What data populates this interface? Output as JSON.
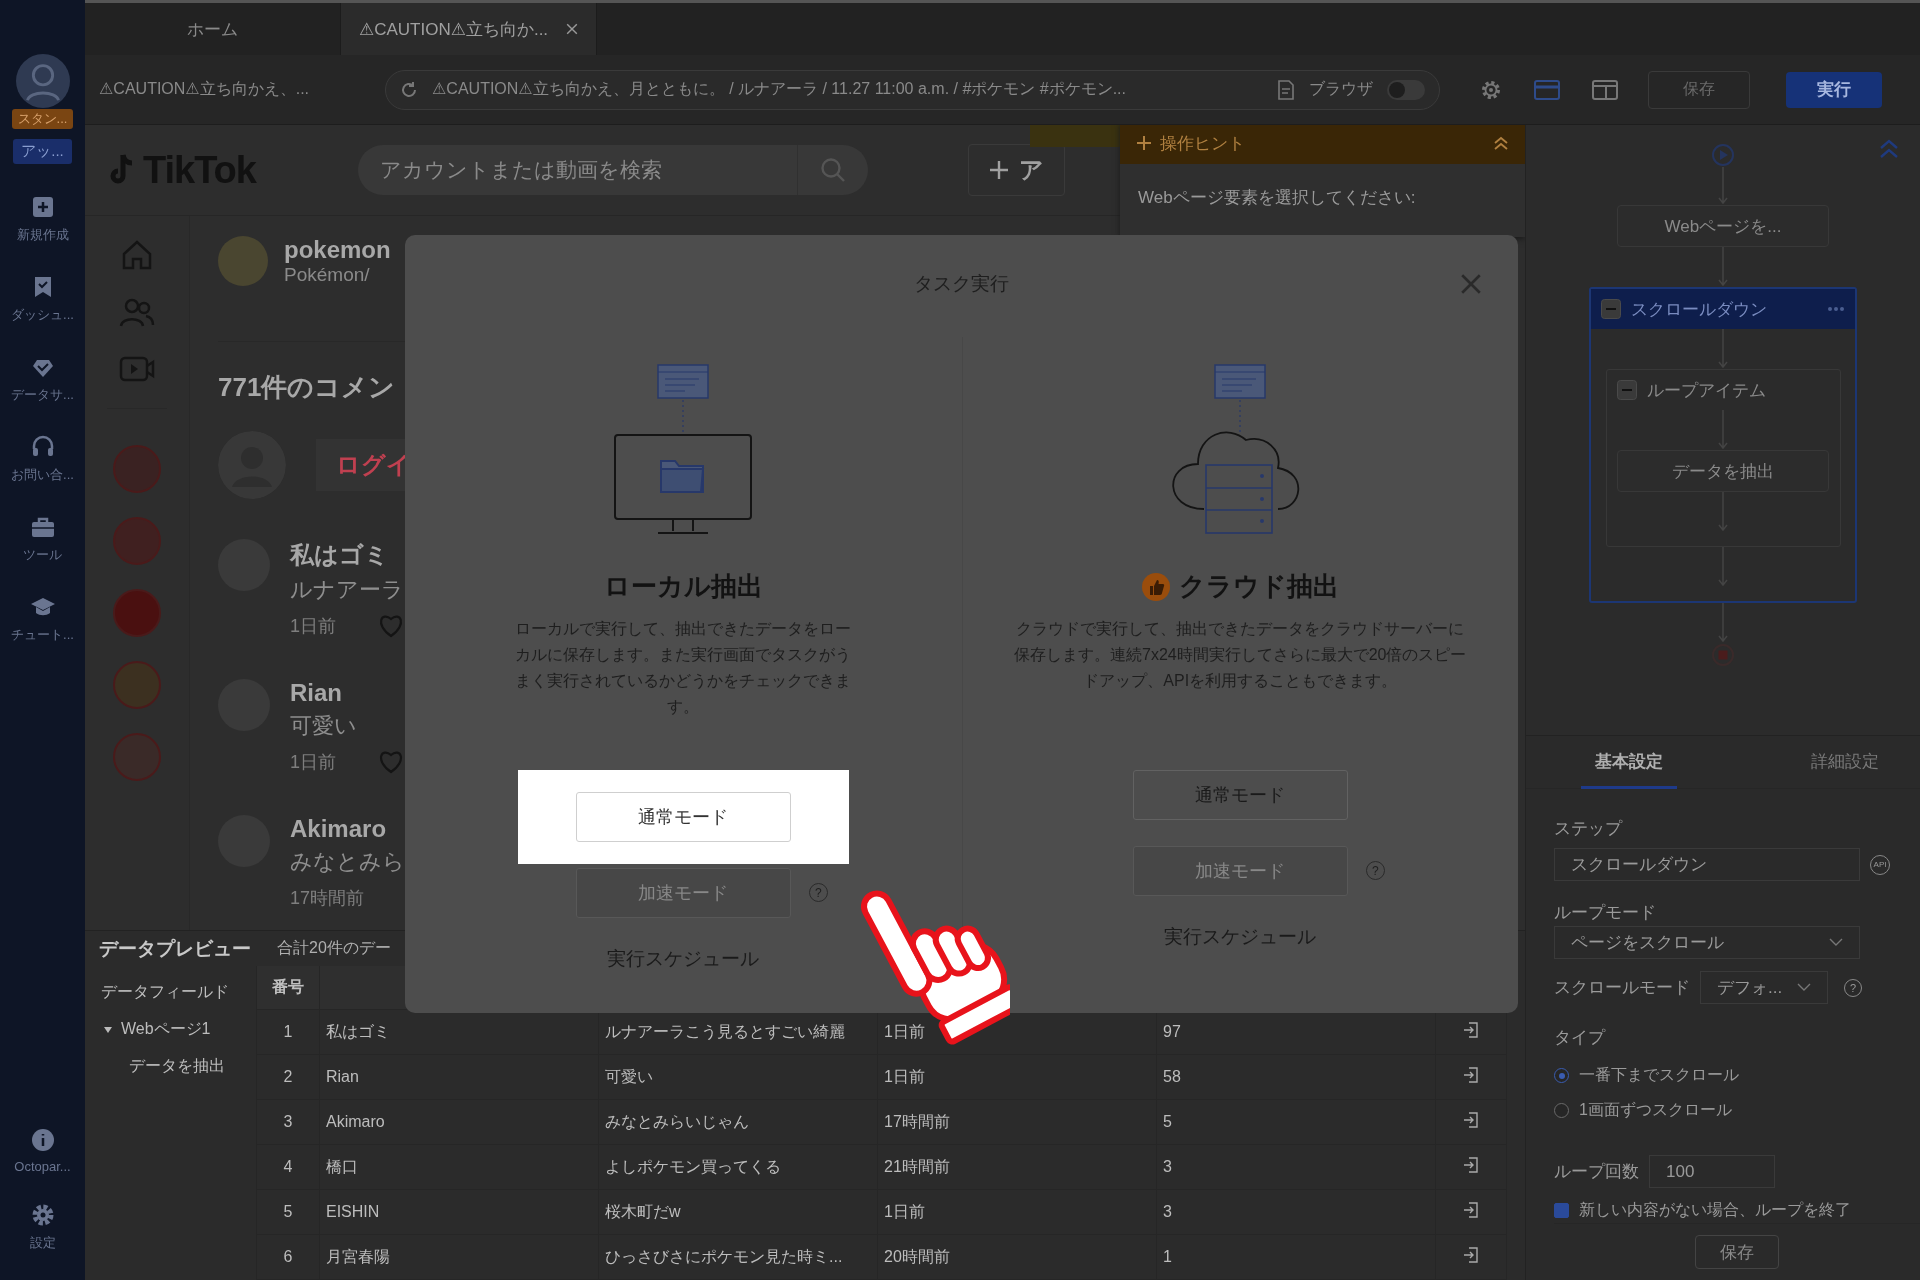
{
  "sidebar": {
    "plan_badge": "スタン...",
    "account_badge": "アッ...",
    "items": [
      {
        "label": "新規作成"
      },
      {
        "label": "ダッシュ..."
      },
      {
        "label": "データサ..."
      },
      {
        "label": "お問い合..."
      },
      {
        "label": "ツール"
      },
      {
        "label": "チュート..."
      }
    ],
    "bottom_items": [
      {
        "label": "Octopar..."
      },
      {
        "label": "設定"
      }
    ]
  },
  "tabs": [
    {
      "label": "ホーム",
      "selected": false,
      "closable": false
    },
    {
      "label": "⚠CAUTION⚠立ち向か...",
      "selected": true,
      "closable": true
    }
  ],
  "address_bar": {
    "page_title": "⚠CAUTION⚠立ち向かえ、...",
    "url": "⚠CAUTION⚠立ち向かえ、月とともに。 / ルナアーラ / 11.27 11:00 a.m. / #ポケモン #ポケモン...",
    "browser_toggle": {
      "label": "ブラウザ",
      "on": false
    }
  },
  "toolbar": {
    "save": {
      "label": "保存",
      "disabled": true
    },
    "run": {
      "label": "実行"
    }
  },
  "tiktok": {
    "logo": "TikTok",
    "search_placeholder": "アカウントまたは動画を検索",
    "upload_button": "ア",
    "account": {
      "name": "pokemon",
      "handle": "Pokémon/"
    },
    "comment_count": "771件のコメン",
    "login": "ログイ",
    "comments": [
      {
        "user": "私はゴミ",
        "text": "ルナアーラ",
        "time": "1日前",
        "heart": true
      },
      {
        "user": "Rian",
        "text": "可愛い",
        "time": "1日前",
        "heart": true
      },
      {
        "user": "Akimaro",
        "text": "みなとみら",
        "time": "17時間前",
        "heart": false
      }
    ]
  },
  "hint_panel": {
    "title": "操作ヒント",
    "text": "Webページ要素を選択してください:"
  },
  "workflow": {
    "steps": [
      {
        "kind": "action",
        "label": "Webページを..."
      },
      {
        "kind": "loop",
        "label": "スクロールダウン",
        "selected": true,
        "expanded": true,
        "children": [
          {
            "kind": "loop",
            "label": "ループアイテム",
            "selected": false,
            "expanded": true,
            "children": [
              {
                "kind": "action",
                "label": "データを抽出"
              }
            ]
          }
        ]
      }
    ]
  },
  "settings": {
    "tabs": [
      {
        "label": "基本設定",
        "selected": true
      },
      {
        "label": "詳細設定",
        "selected": false
      }
    ],
    "step_label": "ステップ",
    "step_value": "スクロールダウン",
    "api_icon": "API",
    "loop_mode_label": "ループモード",
    "loop_mode_value": "ページをスクロール",
    "scroll_mode_label": "スクロールモード",
    "scroll_mode_value": "デフォ...",
    "scroll_mode_help": "?",
    "type_label": "タイプ",
    "type_options": [
      {
        "label": "一番下までスクロール",
        "selected": true
      },
      {
        "label": "1画面ずつスクロール",
        "selected": false
      }
    ],
    "loop_count_label": "ループ回数",
    "loop_count_value": "100",
    "end_checkbox": {
      "label": "新しい内容がない場合、ループを終了",
      "checked": true
    },
    "save": "保存"
  },
  "preview": {
    "title": "データプレビュー",
    "count": "合計20件のデー",
    "fields_title": "データフィールド",
    "tree": [
      {
        "label": "Webページ1",
        "expanded": true,
        "children": [
          {
            "label": "データを抽出"
          }
        ]
      }
    ],
    "table": {
      "columns": [
        "番号"
      ],
      "rows": [
        [
          "1",
          "私はゴミ",
          "ルナアーラこう見るとすごい綺麗",
          "1日前",
          "97"
        ],
        [
          "2",
          "Rian",
          "可愛い",
          "1日前",
          "58"
        ],
        [
          "3",
          "Akimaro",
          "みなとみらいじゃん",
          "17時間前",
          "5"
        ],
        [
          "4",
          "橋口",
          "よしポケモン買ってくる",
          "21時間前",
          "3"
        ],
        [
          "5",
          "EISHIN",
          "桜木町だw",
          "1日前",
          "3"
        ],
        [
          "6",
          "月宮春陽",
          "ひっさびさにポケモン見た時ミ...",
          "20時間前",
          "1"
        ]
      ]
    }
  },
  "modal": {
    "title": "タスク実行",
    "options": [
      {
        "kind": "local",
        "title": "ローカル抽出",
        "description": "ローカルで実行して、抽出できたデータをローカルに保存します。また実行画面でタスクがうまく実行されているかどうかをチェックできます。",
        "normal_button": {
          "label": "通常モード",
          "highlighted": true
        },
        "fast_button": {
          "label": "加速モード",
          "disabled": true
        },
        "help": "?",
        "schedule": "実行スケジュール"
      },
      {
        "kind": "cloud",
        "title": "クラウド抽出",
        "description": "クラウドで実行して、抽出できたデータをクラウドサーバーに保存します。連続7x24時間実行してさらに最大で20倍のスピードアップ、APIを利用することもできます。",
        "normal_button": {
          "label": "通常モード",
          "highlighted": false
        },
        "fast_button": {
          "label": "加速モード",
          "disabled": true
        },
        "help": "?",
        "schedule": "実行スケジュール"
      }
    ]
  }
}
